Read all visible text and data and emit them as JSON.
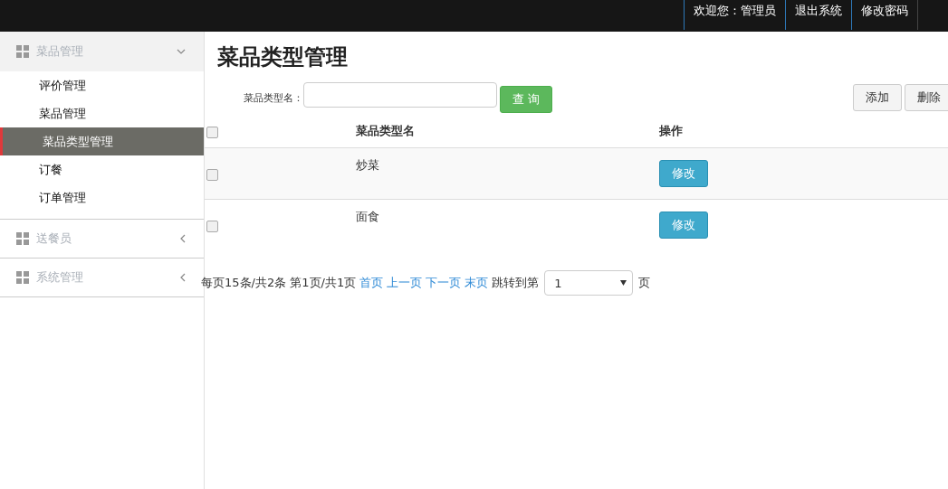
{
  "topbar": {
    "links": [
      "欢迎您：管理员",
      "退出系统",
      "修改密码"
    ]
  },
  "sidebar": {
    "groups": [
      {
        "label": "菜品管理",
        "expanded": true,
        "items": [
          {
            "label": "评价管理",
            "selected": false
          },
          {
            "label": "菜品管理",
            "selected": false
          },
          {
            "label": "菜品类型管理",
            "selected": true
          },
          {
            "label": "订餐",
            "selected": false
          },
          {
            "label": "订单管理",
            "selected": false
          }
        ]
      },
      {
        "label": "送餐员",
        "expanded": false
      },
      {
        "label": "系统管理",
        "expanded": false
      }
    ]
  },
  "page_title": "菜品类型管理",
  "search": {
    "label": "菜品类型名：",
    "button": "查 询"
  },
  "actions": [
    "添加",
    "删除"
  ],
  "table": {
    "all_checked": false,
    "columns": [
      "菜品类型名",
      "操作"
    ],
    "rows": [
      {
        "checked": false,
        "name": "炒菜",
        "action": "修改"
      },
      {
        "checked": false,
        "name": "面食",
        "action": "修改"
      }
    ]
  },
  "pagination": {
    "summary": "每页15条/共2条 第1页/共1页",
    "links": [
      "首页",
      "上一页",
      "下一页",
      "末页"
    ],
    "jump_label": "跳转到第",
    "page": "1",
    "suffix": "页"
  }
}
